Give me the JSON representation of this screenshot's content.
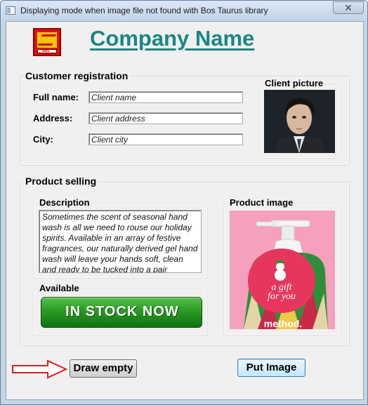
{
  "window": {
    "title": "Displaying mode when image file not found with Bos Taurus library",
    "close_glyph": "✕"
  },
  "logo": {
    "text": "NBS"
  },
  "company_name": "Company Name",
  "customer": {
    "group_label": "Customer registration",
    "fields": [
      {
        "label": "Full name:",
        "value": "Client name"
      },
      {
        "label": "Address:",
        "value": "Client address"
      },
      {
        "label": "City:",
        "value": "Client city"
      }
    ],
    "picture_label": "Client picture"
  },
  "product": {
    "group_label": "Product selling",
    "description_label": "Description",
    "description_text": "Sometimes the scent of seasonal hand wash is all we need to rouse our holiday spirits. Available in an array of festive fragrances, our naturally derived gel hand wash will leave your hands soft, clean and ready to be tucked into a pair",
    "available_label": "Available",
    "stock_banner": "IN STOCK NOW",
    "image_label": "Product image",
    "image_tag_line1": "a gift",
    "image_tag_line2": "for you",
    "image_brand": "method."
  },
  "buttons": {
    "draw_empty": "Draw empty",
    "put_image": "Put Image"
  },
  "colors": {
    "company": "#1a8686",
    "window_frame": "#c5d5e8",
    "dialog_bg": "#f0f0f0",
    "stock_green": "#2b9a25",
    "arrow_red": "#d62020"
  },
  "icons": [
    "app-icon",
    "close-icon",
    "red-arrow-icon"
  ]
}
